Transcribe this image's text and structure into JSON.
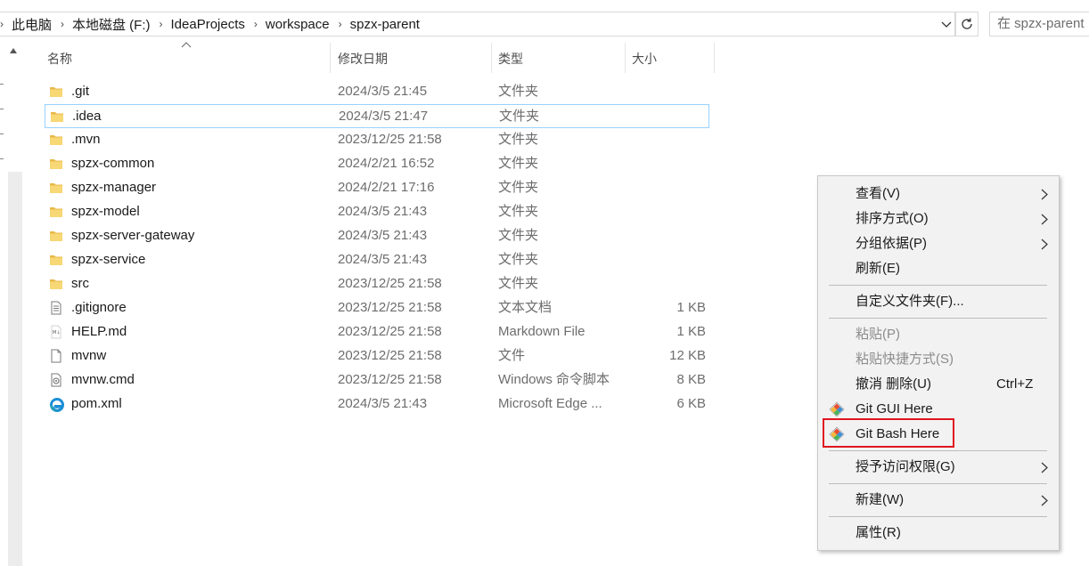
{
  "address": {
    "crumbs": [
      "此电脑",
      "本地磁盘 (F:)",
      "IdeaProjects",
      "workspace",
      "spzx-parent"
    ]
  },
  "search": {
    "placeholder": "在 spzx-parent 中搜索"
  },
  "columns": {
    "name": "名称",
    "modified": "修改日期",
    "type": "类型",
    "size": "大小"
  },
  "files": [
    {
      "name": ".git",
      "modified": "2024/3/5 21:45",
      "type": "文件夹",
      "size": "",
      "icon": "folder-icon"
    },
    {
      "name": ".idea",
      "modified": "2024/3/5 21:47",
      "type": "文件夹",
      "size": "",
      "icon": "folder-icon",
      "focused": true
    },
    {
      "name": ".mvn",
      "modified": "2023/12/25 21:58",
      "type": "文件夹",
      "size": "",
      "icon": "folder-icon"
    },
    {
      "name": "spzx-common",
      "modified": "2024/2/21 16:52",
      "type": "文件夹",
      "size": "",
      "icon": "folder-icon"
    },
    {
      "name": "spzx-manager",
      "modified": "2024/2/21 17:16",
      "type": "文件夹",
      "size": "",
      "icon": "folder-icon"
    },
    {
      "name": "spzx-model",
      "modified": "2024/3/5 21:43",
      "type": "文件夹",
      "size": "",
      "icon": "folder-icon"
    },
    {
      "name": "spzx-server-gateway",
      "modified": "2024/3/5 21:43",
      "type": "文件夹",
      "size": "",
      "icon": "folder-icon"
    },
    {
      "name": "spzx-service",
      "modified": "2024/3/5 21:43",
      "type": "文件夹",
      "size": "",
      "icon": "folder-icon"
    },
    {
      "name": "src",
      "modified": "2023/12/25 21:58",
      "type": "文件夹",
      "size": "",
      "icon": "folder-icon"
    },
    {
      "name": ".gitignore",
      "modified": "2023/12/25 21:58",
      "type": "文本文档",
      "size": "1 KB",
      "icon": "text-file-icon"
    },
    {
      "name": "HELP.md",
      "modified": "2023/12/25 21:58",
      "type": "Markdown File",
      "size": "1 KB",
      "icon": "markdown-file-icon"
    },
    {
      "name": "mvnw",
      "modified": "2023/12/25 21:58",
      "type": "文件",
      "size": "12 KB",
      "icon": "blank-file-icon"
    },
    {
      "name": "mvnw.cmd",
      "modified": "2023/12/25 21:58",
      "type": "Windows 命令脚本",
      "size": "8 KB",
      "icon": "cmd-file-icon"
    },
    {
      "name": "pom.xml",
      "modified": "2024/3/5 21:43",
      "type": "Microsoft Edge ...",
      "size": "6 KB",
      "icon": "edge-icon"
    }
  ],
  "context_menu": {
    "view": "查看(V)",
    "sort": "排序方式(O)",
    "group": "分组依据(P)",
    "refresh": "刷新(E)",
    "customize": "自定义文件夹(F)...",
    "paste": "粘贴(P)",
    "paste_shortcut": "粘贴快捷方式(S)",
    "undo": "撤消 删除(U)",
    "undo_shortcut": "Ctrl+Z",
    "git_gui": "Git GUI Here",
    "git_bash": "Git Bash Here",
    "grant_access": "授予访问权限(G)",
    "new": "新建(W)",
    "properties": "属性(R)"
  },
  "colors": {
    "highlight_box": "#e0161f",
    "focus_border": "#99d1ff",
    "folder": "#f8d775"
  }
}
